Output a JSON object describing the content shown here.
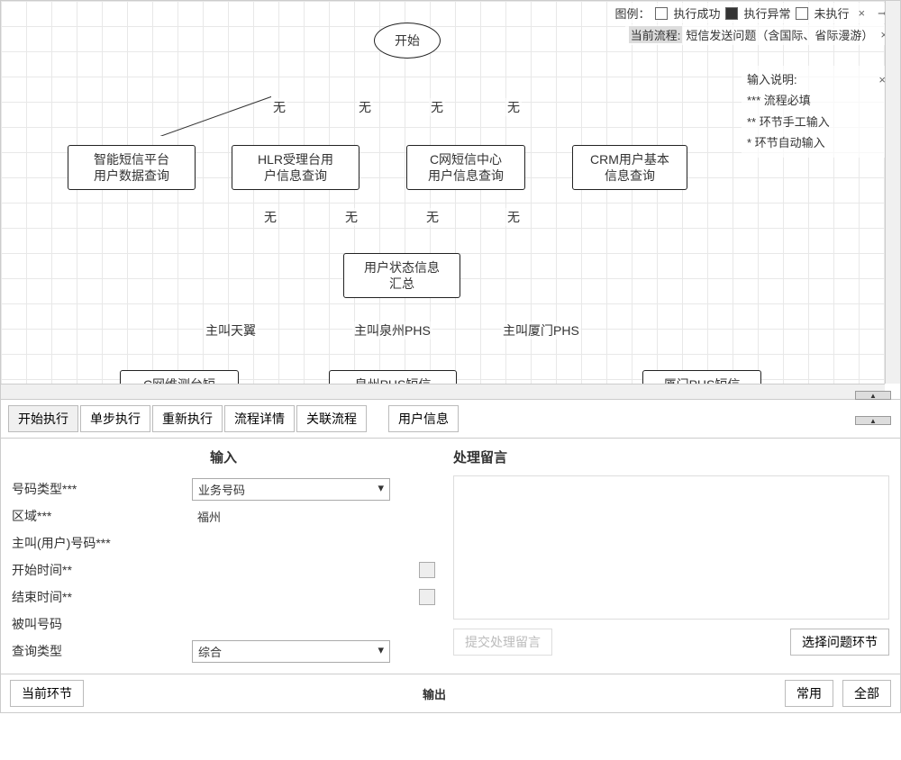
{
  "legend": {
    "label": "图例：",
    "success": "执行成功",
    "error": "执行异常",
    "not_run": "未执行"
  },
  "current_process": {
    "label": "当前流程:",
    "value": "短信发送问题（含国际、省际漫游）"
  },
  "input_legend": {
    "title": "输入说明:",
    "l1": "*** 流程必填",
    "l2": "** 环节手工输入",
    "l3": "* 环节自动输入"
  },
  "nodes": {
    "start": "开始",
    "n1a": "智能短信平台",
    "n1b": "用户数据查询",
    "n2a": "HLR受理台用",
    "n2b": "户信息查询",
    "n3a": "C网短信中心",
    "n3b": "用户信息查询",
    "n4a": "CRM用户基本",
    "n4b": "信息查询",
    "n5a": "用户状态信息",
    "n5b": "汇总",
    "n6": "C网维测台短",
    "n7": "泉州PHS短信",
    "n8": "厦门PHS短信"
  },
  "edge_labels": {
    "none": "无",
    "zjty": "主叫天翼",
    "zjqz": "主叫泉州PHS",
    "zjxm": "主叫厦门PHS"
  },
  "toolbar": {
    "start": "开始执行",
    "step": "单步执行",
    "rerun": "重新执行",
    "detail": "流程详情",
    "related": "关联流程",
    "user": "用户信息"
  },
  "form": {
    "input_title": "输入",
    "msg_title": "处理留言",
    "f1": "号码类型***",
    "v1": "业务号码",
    "f2": "区域***",
    "v2": "福州",
    "f3": "主叫(用户)号码***",
    "f4": "开始时间**",
    "f5": "结束时间**",
    "f6": "被叫号码",
    "f7": "查询类型",
    "v7": "综合",
    "submit_msg": "提交处理留言",
    "choose_node": "选择问题环节"
  },
  "bottom": {
    "current": "当前环节",
    "output": "输出",
    "common": "常用",
    "all": "全部"
  }
}
